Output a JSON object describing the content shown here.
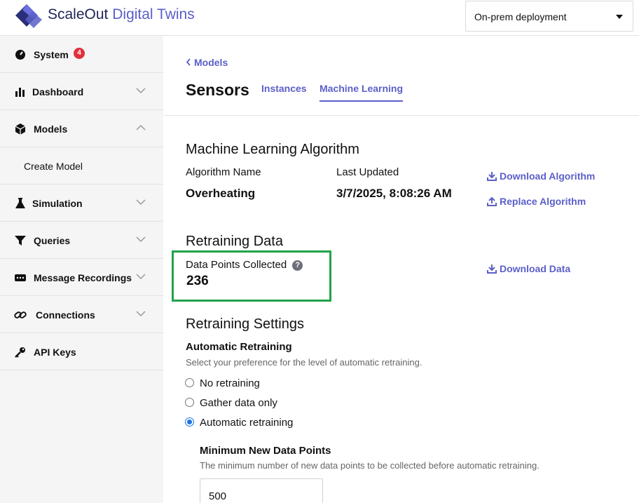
{
  "app": {
    "brand_part1": "ScaleOut",
    "brand_part2": "Digital Twins"
  },
  "header": {
    "deployment_select": "On-prem deployment"
  },
  "sidebar": {
    "items": [
      {
        "label": "System",
        "icon": "gauge-icon",
        "badge": "4"
      },
      {
        "label": "Dashboard",
        "icon": "bar-chart-icon",
        "expanded": false
      },
      {
        "label": "Models",
        "icon": "cube-icon",
        "expanded": true
      },
      {
        "label": "Create Model",
        "sub": true
      },
      {
        "label": "Simulation",
        "icon": "flask-icon",
        "expanded": false
      },
      {
        "label": "Queries",
        "icon": "filter-icon",
        "expanded": false
      },
      {
        "label": "Message Recordings",
        "icon": "message-icon",
        "expanded": false
      },
      {
        "label": "Connections",
        "icon": "link-icon",
        "expanded": false
      },
      {
        "label": "API Keys",
        "icon": "key-icon"
      }
    ]
  },
  "breadcrumb": {
    "back_label": "Models"
  },
  "page": {
    "title": "Sensors",
    "tabs": [
      {
        "label": "Instances",
        "active": false
      },
      {
        "label": "Machine Learning",
        "active": true
      }
    ]
  },
  "ml": {
    "section_title": "Machine Learning Algorithm",
    "algorithm_name_label": "Algorithm Name",
    "algorithm_name": "Overheating",
    "last_updated_label": "Last Updated",
    "last_updated": "3/7/2025, 8:08:26 AM",
    "download_algorithm": "Download Algorithm",
    "replace_algorithm": "Replace Algorithm"
  },
  "retraining_data": {
    "section_title": "Retraining Data",
    "points_label": "Data Points Collected",
    "points_value": "236",
    "download_data": "Download Data",
    "help_glyph": "?"
  },
  "retraining_settings": {
    "section_title": "Retraining Settings",
    "auto_heading": "Automatic Retraining",
    "auto_help": "Select your preference for the level of automatic retraining.",
    "options": [
      {
        "label": "No retraining",
        "checked": false
      },
      {
        "label": "Gather data only",
        "checked": false
      },
      {
        "label": "Automatic retraining",
        "checked": true
      }
    ],
    "min_points_heading": "Minimum New Data Points",
    "min_points_help": "The minimum number of new data points to be collected before automatic retraining.",
    "min_points_value": "500"
  },
  "colors": {
    "accent": "#5b5fc7",
    "badge": "#e0303c",
    "highlight": "#22a34a",
    "sidebar_bg": "#f5f5f5"
  }
}
